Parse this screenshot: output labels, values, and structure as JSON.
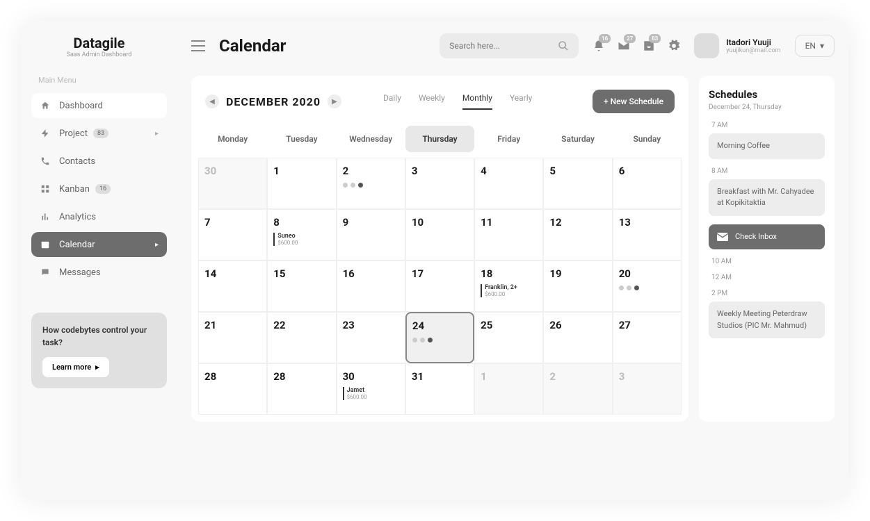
{
  "brand": {
    "title": "Datagile",
    "subtitle": "Saas Admin Dashboard"
  },
  "sidebar": {
    "section": "Main Menu",
    "items": [
      {
        "label": "Dashboard"
      },
      {
        "label": "Project",
        "badge": "83"
      },
      {
        "label": "Contacts"
      },
      {
        "label": "Kanban",
        "badge": "16"
      },
      {
        "label": "Analytics"
      },
      {
        "label": "Calendar"
      },
      {
        "label": "Messages"
      }
    ],
    "promo": {
      "text": "How codebytes control your task?",
      "button": "Learn more"
    }
  },
  "page": {
    "title": "Calendar"
  },
  "search": {
    "placeholder": "Search here..."
  },
  "notifications": {
    "bell": "16",
    "mail": "27",
    "inbox": "83"
  },
  "user": {
    "name": "Itadori Yuuji",
    "email": "yuujikun@mail.com"
  },
  "lang": "EN",
  "calendar": {
    "month": "DECEMBER 2020",
    "views": [
      "Daily",
      "Weekly",
      "Monthly",
      "Yearly"
    ],
    "new_button": "+ New Schedule",
    "weekdays": [
      "Monday",
      "Tuesday",
      "Wednesday",
      "Thursday",
      "Friday",
      "Saturday",
      "Sunday"
    ],
    "events": {
      "e8": {
        "title": "Suneo",
        "amount": "$600.00"
      },
      "e18": {
        "title": "Franklin, 2+",
        "amount": "$600.00"
      },
      "e30b": {
        "title": "Jamet",
        "amount": "$600.00"
      }
    }
  },
  "schedule": {
    "title": "Schedules",
    "date": "December 24, Thursday",
    "times": {
      "t1": "7 AM",
      "t2": "8 AM",
      "t3": "10 AM",
      "t4": "12 AM",
      "t5": "2 PM"
    },
    "items": {
      "morning": "Morning Coffee",
      "breakfast": "Breakfast with Mr. Cahyadee at Kopikitaktia",
      "inbox": "Check Inbox",
      "meeting": "Weekly Meeting Peterdraw Studios (PIC Mr. Mahmud)"
    }
  }
}
